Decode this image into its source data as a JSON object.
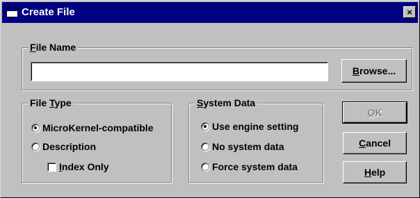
{
  "window": {
    "title": "Create File",
    "icon": "window-icon",
    "close_glyph": "×"
  },
  "file_name": {
    "group_label_first": "F",
    "group_label_rest": "ile Name",
    "value": "",
    "browse_label_first": "B",
    "browse_label_rest": "rowse..."
  },
  "file_type": {
    "group_label_head": "File ",
    "group_label_underline": "T",
    "group_label_tail": "ype",
    "options": [
      {
        "label": "MicroKernel-compatible",
        "checked": true
      },
      {
        "label": "Description",
        "checked": false
      }
    ],
    "index_only": {
      "label_first": "I",
      "label_rest": "ndex Only",
      "checked": false
    }
  },
  "system_data": {
    "group_label_first": "S",
    "group_label_rest": "ystem Data",
    "options": [
      {
        "label": "Use engine setting",
        "checked": true
      },
      {
        "label": "No system data",
        "checked": false
      },
      {
        "label": "Force system data",
        "checked": false
      }
    ]
  },
  "buttons": {
    "ok": {
      "first": "O",
      "rest": "K",
      "enabled": false
    },
    "cancel": {
      "first": "C",
      "rest": "ancel"
    },
    "help": {
      "first": "H",
      "rest": "elp"
    }
  },
  "colors": {
    "titlebar": "#000080",
    "face": "#c0c0c0",
    "disabled_text": "#808080"
  }
}
